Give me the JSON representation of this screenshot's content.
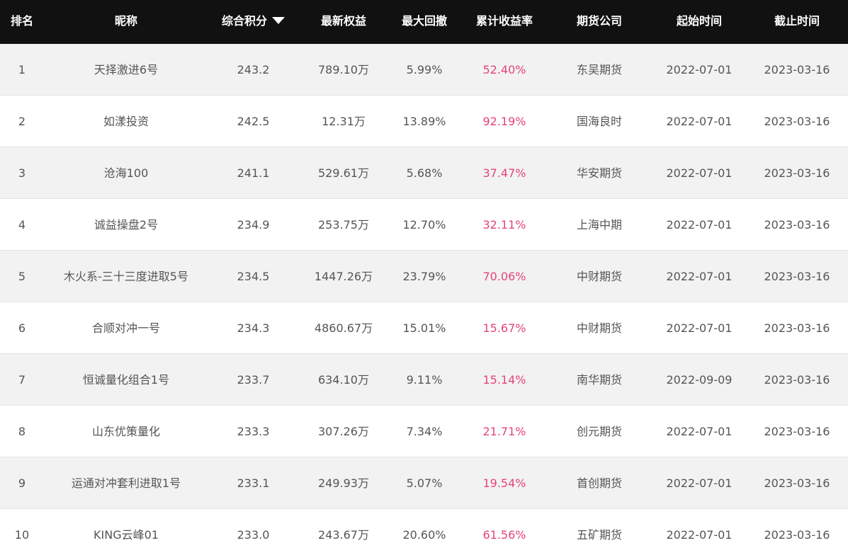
{
  "header": {
    "rank": "排名",
    "nickname": "昵称",
    "score": "综合积分",
    "equity": "最新权益",
    "max_drawdown": "最大回撤",
    "cum_return": "累计收益率",
    "broker": "期货公司",
    "start": "起始时间",
    "end": "截止时间"
  },
  "colors": {
    "header_bg": "#111111",
    "row_alt_bg": "#f2f2f2",
    "yield_color": "#e4447a",
    "text_color": "#555555"
  },
  "rows": [
    {
      "rank": "1",
      "name": "天择激进6号",
      "score": "243.2",
      "equity": "789.10万",
      "drawdown": "5.99%",
      "return": "52.40%",
      "broker": "东吴期货",
      "start": "2022-07-01",
      "end": "2023-03-16"
    },
    {
      "rank": "2",
      "name": "如漾投资",
      "score": "242.5",
      "equity": "12.31万",
      "drawdown": "13.89%",
      "return": "92.19%",
      "broker": "国海良时",
      "start": "2022-07-01",
      "end": "2023-03-16"
    },
    {
      "rank": "3",
      "name": "沧海100",
      "score": "241.1",
      "equity": "529.61万",
      "drawdown": "5.68%",
      "return": "37.47%",
      "broker": "华安期货",
      "start": "2022-07-01",
      "end": "2023-03-16"
    },
    {
      "rank": "4",
      "name": "诚益操盘2号",
      "score": "234.9",
      "equity": "253.75万",
      "drawdown": "12.70%",
      "return": "32.11%",
      "broker": "上海中期",
      "start": "2022-07-01",
      "end": "2023-03-16"
    },
    {
      "rank": "5",
      "name": "木火系-三十三度进取5号",
      "score": "234.5",
      "equity": "1447.26万",
      "drawdown": "23.79%",
      "return": "70.06%",
      "broker": "中财期货",
      "start": "2022-07-01",
      "end": "2023-03-16"
    },
    {
      "rank": "6",
      "name": "合顺对冲一号",
      "score": "234.3",
      "equity": "4860.67万",
      "drawdown": "15.01%",
      "return": "15.67%",
      "broker": "中财期货",
      "start": "2022-07-01",
      "end": "2023-03-16"
    },
    {
      "rank": "7",
      "name": "恒诚量化组合1号",
      "score": "233.7",
      "equity": "634.10万",
      "drawdown": "9.11%",
      "return": "15.14%",
      "broker": "南华期货",
      "start": "2022-09-09",
      "end": "2023-03-16"
    },
    {
      "rank": "8",
      "name": "山东优策量化",
      "score": "233.3",
      "equity": "307.26万",
      "drawdown": "7.34%",
      "return": "21.71%",
      "broker": "创元期货",
      "start": "2022-07-01",
      "end": "2023-03-16"
    },
    {
      "rank": "9",
      "name": "运通对冲套利进取1号",
      "score": "233.1",
      "equity": "249.93万",
      "drawdown": "5.07%",
      "return": "19.54%",
      "broker": "首创期货",
      "start": "2022-07-01",
      "end": "2023-03-16"
    },
    {
      "rank": "10",
      "name": "KING云峰01",
      "score": "233.0",
      "equity": "243.67万",
      "drawdown": "20.60%",
      "return": "61.56%",
      "broker": "五矿期货",
      "start": "2022-07-01",
      "end": "2023-03-16"
    }
  ]
}
